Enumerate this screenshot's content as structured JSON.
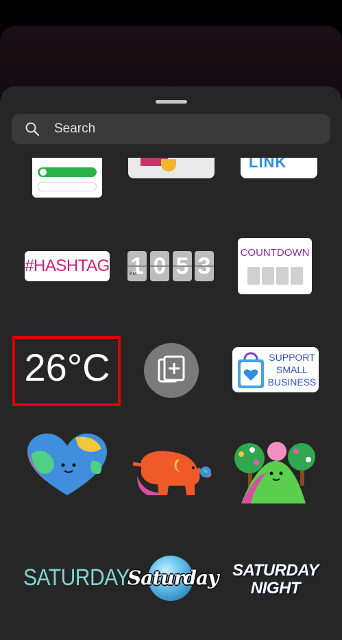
{
  "search": {
    "label": "Search",
    "icon": "search-icon"
  },
  "partial_row": {
    "link_label": "LINK"
  },
  "row2": {
    "hashtag": "#HASHTAG",
    "clock_digits": [
      "1",
      "0",
      "5",
      "3"
    ],
    "clock_period": "PM",
    "countdown": "COUNTDOWN"
  },
  "row3": {
    "weather": "26°C",
    "business_lines": [
      "SUPPORT",
      "SMALL",
      "BUSINESS"
    ]
  },
  "row5": {
    "saturday1": "SATURDAY",
    "saturday2": "Saturday",
    "saturday3_line1": "SATURDAY",
    "saturday3_line2": "NIGHT"
  },
  "colors": {
    "sheet": "#262626",
    "search_bg": "#3a3a3a",
    "highlight": "#e00000",
    "hashtag": "#cf1f74",
    "countdown": "#8a2ea0",
    "business": "#2f55c8"
  }
}
